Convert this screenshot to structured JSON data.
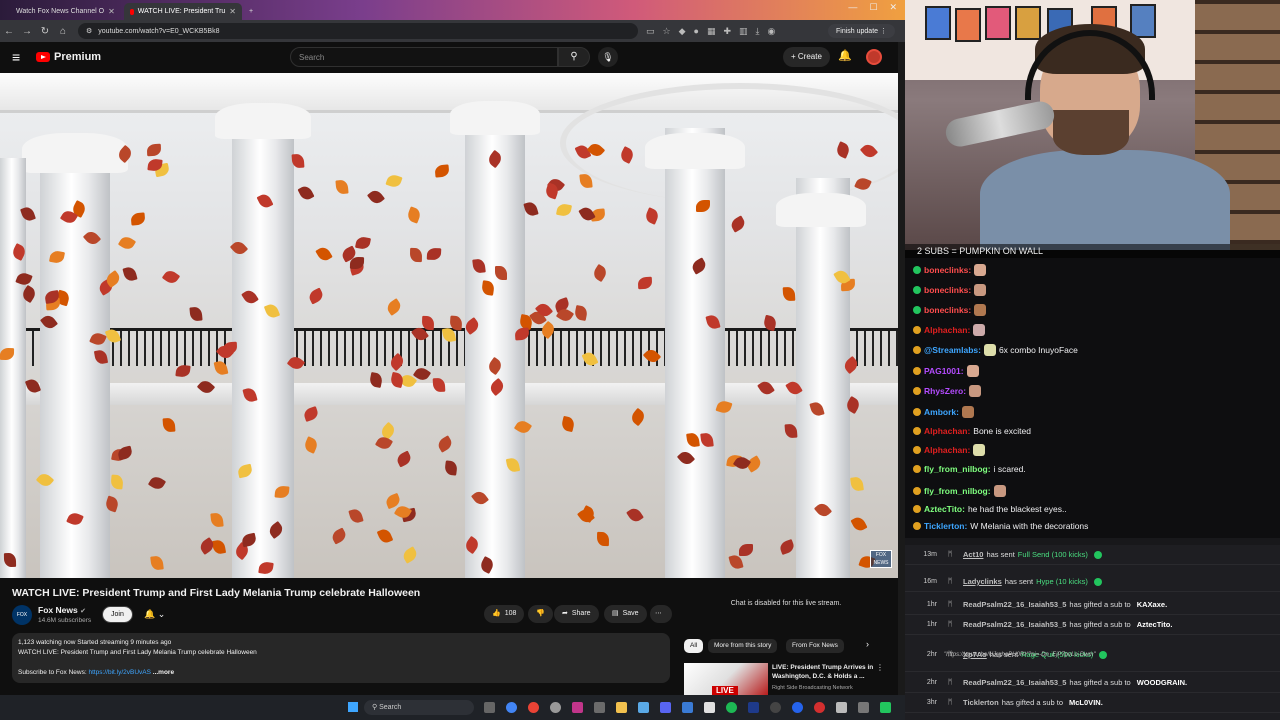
{
  "browser": {
    "tabs": [
      {
        "label": "Watch Fox News Channel O"
      },
      {
        "label": "WATCH LIVE: President Tru"
      }
    ],
    "url": "youtube.com/watch?v=E0_WCKB5Bk8",
    "finish_update": "Finish update"
  },
  "youtube": {
    "brand": "Premium",
    "search_placeholder": "Search",
    "create_label": "Create"
  },
  "video": {
    "title": "WATCH LIVE: President Trump and First Lady Melania Trump celebrate Halloween",
    "channel": "Fox News",
    "subscribers": "14.6M subscribers",
    "join_label": "Join",
    "likes": "108",
    "share_label": "Share",
    "save_label": "Save",
    "bug_text": "FOX NEWS",
    "description": {
      "stats": "1,123 watching now  Started streaming 9 minutes ago",
      "line1": "WATCH LIVE: President Trump and First Lady Melania Trump celebrate Halloween",
      "subscribe_prefix": "Subscribe to Fox News: ",
      "subscribe_link": "https://bit.ly/2vBUvAS",
      "more": "...more"
    }
  },
  "sidebar": {
    "chat_disabled": "Chat is disabled for this live stream.",
    "chips": [
      "All",
      "More from this story",
      "From Fox News"
    ],
    "recommendation": {
      "thumb_label": "LIVE",
      "title": "LIVE: President Trump Arrives in Washington, D.C. & Holds a ...",
      "channel": "Right Side Broadcasting Network"
    }
  },
  "taskbar": {
    "search_label": "Search"
  },
  "stream": {
    "cam_caption": "2 SUBS = PUMPKIN ON WALL",
    "chat": [
      {
        "user": "boneclinks:",
        "text": "",
        "color": "#ff4d4d"
      },
      {
        "user": "boneclinks:",
        "text": "",
        "color": "#ff4d4d"
      },
      {
        "user": "boneclinks:",
        "text": "",
        "color": "#ff4d4d"
      },
      {
        "user": "Alphachan:",
        "text": "",
        "color": "#e02020"
      },
      {
        "user": "@Streamlabs:",
        "text": "6x    combo InuyoFace",
        "color": "#3ea6ff"
      },
      {
        "user": "PAG1001:",
        "text": "",
        "color": "#b44cff"
      },
      {
        "user": "RhysZero:",
        "text": "",
        "color": "#b44cff"
      },
      {
        "user": "Ambork:",
        "text": "",
        "color": "#3ea6ff"
      },
      {
        "user": "Alphachan:",
        "text": "Bone is excited",
        "color": "#e02020"
      },
      {
        "user": "Alphachan:",
        "text": "",
        "color": "#e02020"
      },
      {
        "user": "fly_from_nilbog:",
        "text": "i scared.",
        "color": "#7fff7f"
      },
      {
        "user": "fly_from_nilbog:",
        "text": "",
        "color": "#7fff7f"
      },
      {
        "user": "AztecTito:",
        "text": "he had the blackest eyes..",
        "color": "#7fff7f"
      },
      {
        "user": "Ticklerton:",
        "text": "W Melania with the decorations",
        "color": "#3ea6ff"
      }
    ],
    "events": [
      {
        "time": "13m",
        "user": "Act10",
        "action": "has sent",
        "item": "Full Send (100 kicks)",
        "target": ""
      },
      {
        "time": "16m",
        "user": "Ladyclinks",
        "action": "has sent",
        "item": "Hype (10 kicks)",
        "target": ""
      },
      {
        "time": "1hr",
        "user": "ReadPsalm22_16_Isaiah53_5",
        "action": "has gifted a sub to",
        "item": "",
        "target": "KAXaxe."
      },
      {
        "time": "1hr",
        "user": "ReadPsalm22_16_Isaiah53_5",
        "action": "has gifted a sub to",
        "item": "",
        "target": "AztecTito."
      },
      {
        "time": "2hr",
        "user": "Xp7Ao",
        "action": "has sent",
        "item": "Rage Quit (500 kicks)",
        "target": "",
        "note": "\"https://youtu.be/UJrghaPU0RY?si=-Dn_EjP7pvLo-Dwm\""
      },
      {
        "time": "2hr",
        "user": "ReadPsalm22_16_Isaiah53_5",
        "action": "has gifted a sub to",
        "item": "",
        "target": "WOODGRAIN."
      },
      {
        "time": "3hr",
        "user": "Ticklerton",
        "action": "has gifted a sub to",
        "item": "",
        "target": "McL0VIN."
      }
    ]
  }
}
